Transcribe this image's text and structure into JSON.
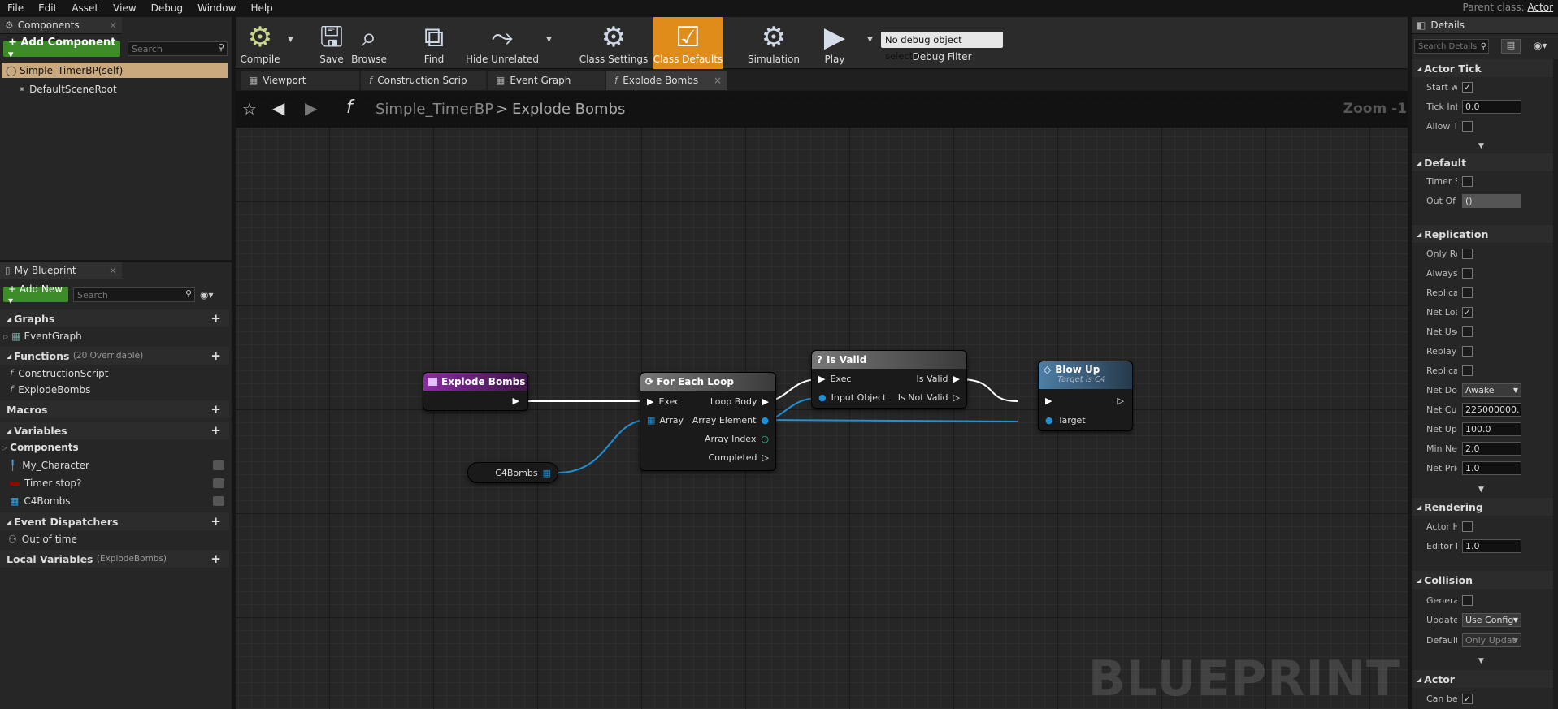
{
  "menu": [
    "File",
    "Edit",
    "Asset",
    "View",
    "Debug",
    "Window",
    "Help"
  ],
  "parent_class": {
    "label": "Parent class:",
    "value": "Actor"
  },
  "components_panel": {
    "title": "Components",
    "add_button": "+ Add Component ▾",
    "search_placeholder": "Search",
    "items": [
      "Simple_TimerBP(self)",
      "DefaultSceneRoot"
    ]
  },
  "my_blueprint": {
    "title": "My Blueprint",
    "add_new": "+ Add New ▾",
    "search_placeholder": "Search",
    "graphs_label": "Graphs",
    "event_graph": "EventGraph",
    "functions_label": "Functions",
    "functions_hint": "(20 Overridable)",
    "functions": [
      "ConstructionScript",
      "ExplodeBombs"
    ],
    "macros_label": "Macros",
    "variables_label": "Variables",
    "components_label": "Components",
    "variables": [
      "My_Character",
      "Timer stop?",
      "C4Bombs"
    ],
    "dispatchers_label": "Event Dispatchers",
    "dispatcher_item": "Out of time",
    "local_vars_label": "Local Variables",
    "local_vars_hint": "(ExplodeBombs)"
  },
  "toolbar": {
    "compile": "Compile",
    "save": "Save",
    "browse": "Browse",
    "find": "Find",
    "hide_unrelated": "Hide Unrelated",
    "class_settings": "Class Settings",
    "class_defaults": "Class Defaults",
    "simulation": "Simulation",
    "play": "Play",
    "debug_object": "No debug object selected ▾",
    "debug_filter": "Debug Filter"
  },
  "tabs": [
    "Viewport",
    "Construction Scrip",
    "Event Graph",
    "Explode Bombs"
  ],
  "breadcrumb": {
    "blueprint": "Simple_TimerBP",
    "separator": ">",
    "function": "Explode Bombs"
  },
  "zoom": "Zoom -1",
  "watermark": "BLUEPRINT",
  "nodes": {
    "entry": {
      "title": "Explode Bombs"
    },
    "foreach": {
      "title": "For Each Loop",
      "exec": "Exec",
      "array": "Array",
      "loop_body": "Loop Body",
      "array_element": "Array Element",
      "array_index": "Array Index",
      "completed": "Completed"
    },
    "isvalid": {
      "title": "Is Valid",
      "exec": "Exec",
      "input": "Input Object",
      "valid": "Is Valid",
      "not_valid": "Is Not Valid"
    },
    "blowup": {
      "title": "Blow Up",
      "subtitle": "Target is C4",
      "target": "Target"
    },
    "c4var": {
      "label": "C4Bombs"
    }
  },
  "details": {
    "title": "Details",
    "search_placeholder": "Search Details",
    "actor_tick": "Actor Tick",
    "start_with_tick": "Start wi",
    "tick_interval": "Tick Inte",
    "tick_value": "0.0",
    "allow_tick": "Allow Ti",
    "default_label": "Default",
    "timer_s": "Timer S",
    "out_of": "Out Of T",
    "out_of_value": "()",
    "replication": "Replication",
    "only_re": "Only Re",
    "always": "Always",
    "replicat": "Replicat",
    "net_load": "Net Loa",
    "net_use": "Net Use",
    "replay": "Replay I",
    "replicat2": "Replicat",
    "net_dormancy": "Net Dor",
    "net_dormancy_value": "Awake",
    "net_cull": "Net Cull",
    "net_cull_value": "225000000.",
    "net_update": "Net Upd",
    "net_update_value": "100.0",
    "min_net": "Min Net",
    "min_net_value": "2.0",
    "net_priority": "Net Prio",
    "net_priority_value": "1.0",
    "rendering": "Rendering",
    "actor_hidden": "Actor H",
    "editor_b": "Editor B",
    "editor_b_value": "1.0",
    "collision": "Collision",
    "generate": "Generat",
    "update": "Update",
    "update_value": "Use Config",
    "default2": "Default",
    "default2_value": "Only Updat",
    "actor": "Actor",
    "can_be": "Can be I"
  }
}
